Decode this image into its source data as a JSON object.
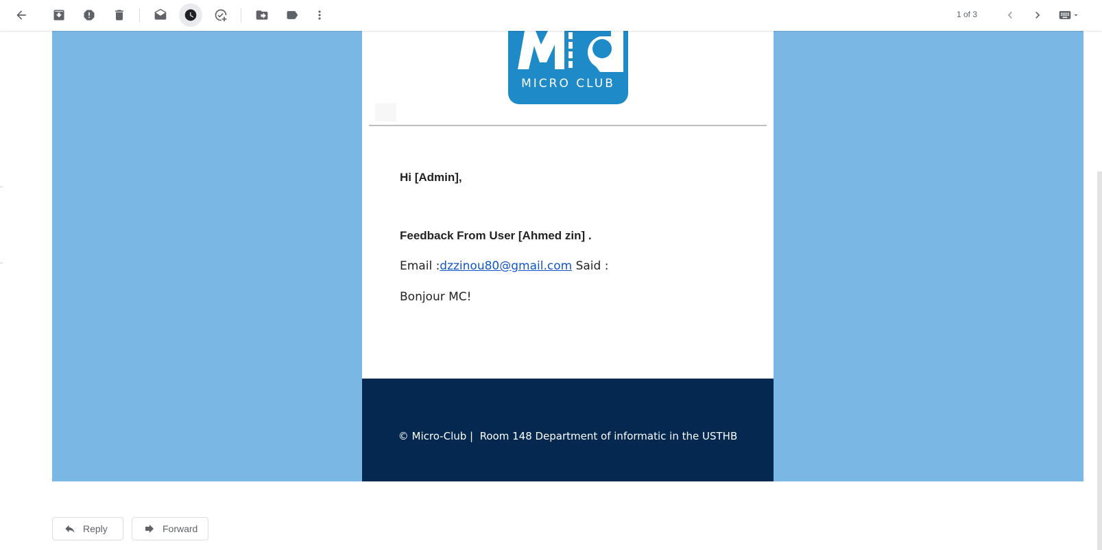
{
  "toolbar": {
    "icons": [
      "back-arrow-icon",
      "archive-icon",
      "report-spam-icon",
      "delete-icon",
      "mark-unread-icon",
      "snooze-icon",
      "add-to-tasks-icon",
      "move-to-icon",
      "labels-icon",
      "more-vert-icon",
      "chevron-left-icon",
      "chevron-right-icon",
      "keyboard-icon",
      "caret-down-icon"
    ],
    "pager": "1 of 3"
  },
  "email": {
    "logo_text": "MICRO CLUB",
    "greeting": "Hi [Admin],",
    "feedback_title": "Feedback From User [Ahmed zin] .",
    "email_prefix": "Email :",
    "email_address": "dzzinou80@gmail.com",
    "email_suffix": " Said :",
    "message": "Bonjour MC!",
    "footer": "© Micro-Club |  Room 148 Department of informatic in the USTHB"
  },
  "actions": {
    "reply": "Reply",
    "forward": "Forward"
  },
  "colors": {
    "canvas": "#7bb7e5",
    "logo": "#1f8ac8",
    "footer": "#04284f",
    "link": "#1155cc"
  }
}
